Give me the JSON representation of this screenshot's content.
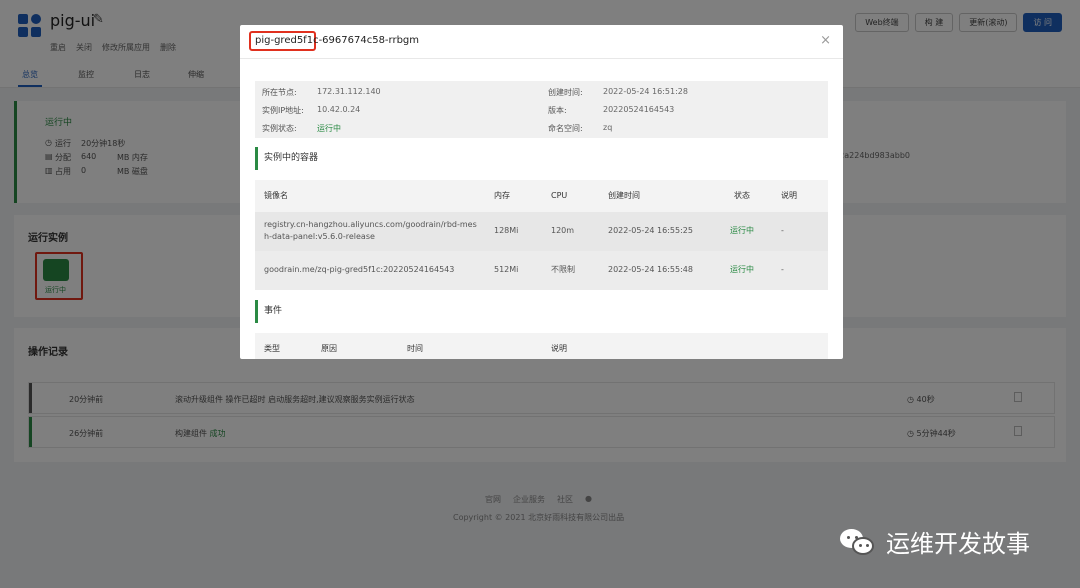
{
  "app": {
    "title": "pig-ui",
    "actions": [
      "重启",
      "关闭",
      "修改所属应用",
      "删除"
    ],
    "top_buttons": [
      "Web终端",
      "构 建",
      "更新(滚动)",
      "访 问"
    ]
  },
  "tabs": [
    "总览",
    "监控",
    "日志",
    "伸缩"
  ],
  "status_card": {
    "status": "运行中",
    "metrics": [
      {
        "icon": "clock-icon",
        "label": "运行",
        "value": "20分钟18秒",
        "unit": ""
      },
      {
        "icon": "memory-icon",
        "label": "分配",
        "value": "640",
        "unit": "MB 内存"
      },
      {
        "icon": "disk-icon",
        "label": "占用",
        "value": "0",
        "unit": "MB 磁盘"
      }
    ],
    "hash": "80c2a224bd983abb0"
  },
  "instances": {
    "title": "运行实例",
    "items": [
      {
        "status": "运行中",
        "color": "#2a8a44"
      }
    ]
  },
  "operation_log": {
    "title": "操作记录",
    "rows": [
      {
        "ago": "20分钟前",
        "message": "滚动升级组件 操作已超时 启动服务超时,建议观察服务实例运行状态",
        "result": "",
        "duration": "40秒",
        "bar_color": "#555555"
      },
      {
        "ago": "26分钟前",
        "message": "构建组件",
        "result": "成功",
        "duration": "5分钟44秒",
        "bar_color": "#2a8a44"
      }
    ]
  },
  "footer": {
    "links": [
      "官网",
      "企业服务",
      "社区"
    ],
    "copyright": "Copyright © 2021 北京好雨科技有限公司出品"
  },
  "modal": {
    "title": "pig-gred5f1c-6967674c58-rrbgm",
    "info": {
      "node_label": "所在节点:",
      "node": "172.31.112.140",
      "ip_label": "实例IP地址:",
      "ip": "10.42.0.24",
      "status_label": "实例状态:",
      "status": "运行中",
      "created_label": "创建时间:",
      "created": "2022-05-24 16:51:28",
      "version_label": "版本:",
      "version": "20220524164543",
      "namespace_label": "命名空间:",
      "namespace": "zq"
    },
    "containers_title": "实例中的容器",
    "containers_headers": [
      "镜像名",
      "内存",
      "CPU",
      "创建时间",
      "状态",
      "说明"
    ],
    "containers": [
      {
        "image_line1": "registry.cn-hangzhou.aliyuncs.com/goodrain/rbd-mes",
        "image_line2": "h-data-panel:v5.6.0-release",
        "memory": "128Mi",
        "cpu": "120m",
        "created": "2022-05-24 16:55:25",
        "status": "运行中",
        "note": "-"
      },
      {
        "image_line1": "goodrain.me/zq-pig-gred5f1c:20220524164543",
        "image_line2": "",
        "memory": "512Mi",
        "cpu": "不限制",
        "created": "2022-05-24 16:55:48",
        "status": "运行中",
        "note": "-"
      }
    ],
    "events_title": "事件",
    "events_headers": [
      "类型",
      "原因",
      "时间",
      "说明"
    ]
  },
  "watermark": {
    "text": "运维开发故事"
  },
  "colors": {
    "accent": "#1f5fbf",
    "success": "#2a8a44",
    "highlight": "#e0301e"
  }
}
